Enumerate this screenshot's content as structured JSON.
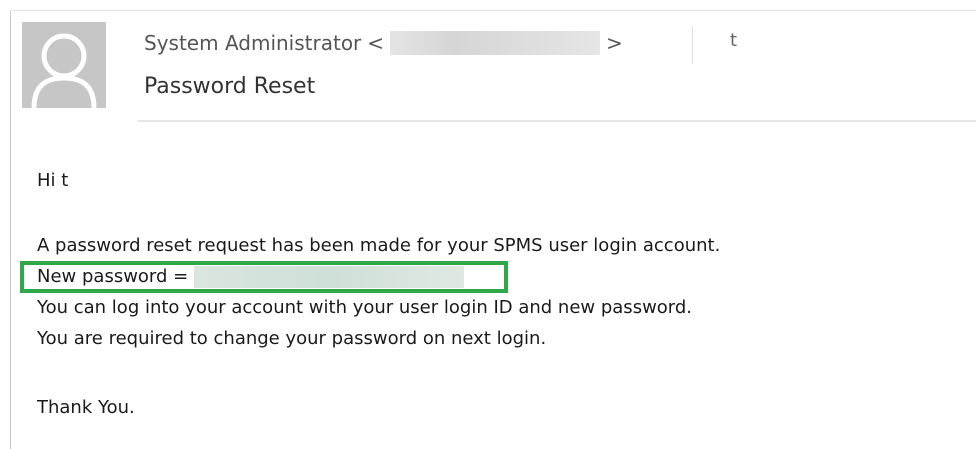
{
  "email": {
    "sender_name": "System Administrator",
    "sender_open_bracket": "<",
    "sender_close_bracket": ">",
    "recipient": "t",
    "subject": "Password Reset"
  },
  "body": {
    "greeting": "Hi t",
    "line1": "A password reset request has been made for your SPMS user login account.",
    "new_password_label": "New password =",
    "line3": "You can log into your account with your user login ID and new password.",
    "line4": "You are required to change your password on next login.",
    "closing": "Thank You."
  },
  "colors": {
    "highlight": "#2fa84a",
    "avatar_bg": "#c6c6c6"
  },
  "icons": {
    "avatar": "user-silhouette-icon"
  }
}
